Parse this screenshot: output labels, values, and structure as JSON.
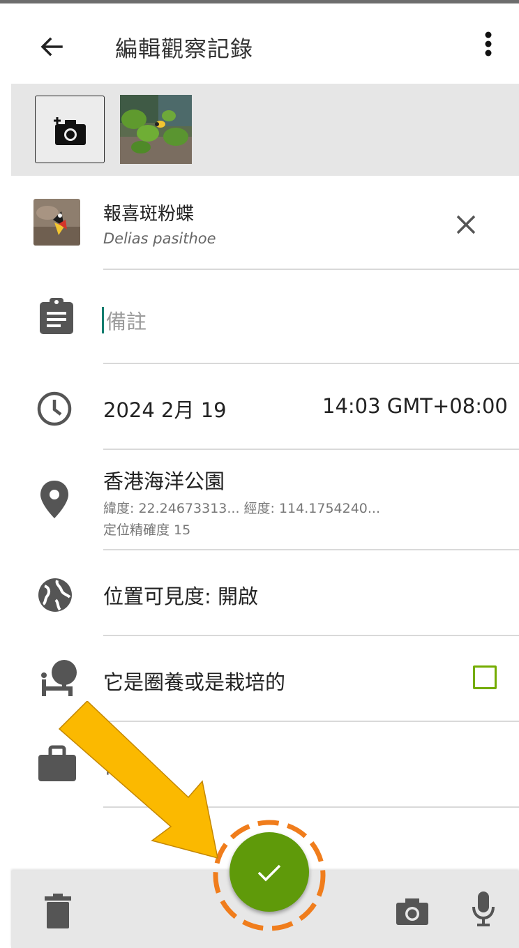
{
  "appbar": {
    "title": "編輯觀察記錄"
  },
  "photos": {
    "add_label": "add-photo",
    "count": 1
  },
  "taxon": {
    "common_name": "報喜斑粉蝶",
    "scientific_name": "Delias pasithoe"
  },
  "notes": {
    "placeholder": "備註"
  },
  "datetime": {
    "date": "2024 2月 19",
    "time": "14:03 GMT+08:00"
  },
  "location": {
    "name": "香港海洋公園",
    "coords": "緯度: 22.24673313...  經度: 114.1754240...",
    "accuracy": "定位精確度 15"
  },
  "visibility": {
    "label": "位置可見度: 開啟"
  },
  "captive": {
    "label": "它是圈養或是栽培的",
    "checked": false
  },
  "projects": {
    "label": "任務"
  },
  "colors": {
    "fab": "#5f9a0a",
    "checkbox": "#74ac00",
    "cursor": "#127c6e",
    "annotation_arrow": "#fbb900",
    "annotation_ring": "#f07d1c"
  }
}
